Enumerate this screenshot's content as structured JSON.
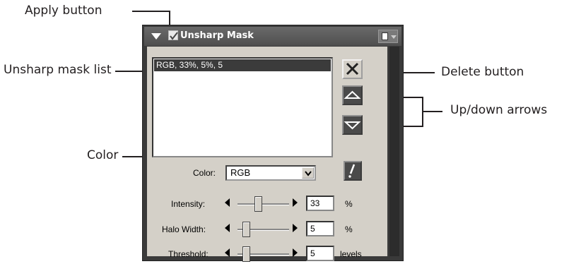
{
  "callouts": {
    "apply_button": "Apply button",
    "unsharp_mask_list": "Unsharp mask list",
    "delete_button": "Delete button",
    "up_down_arrows": "Up/down arrows",
    "color": "Color"
  },
  "palette": {
    "title": "Unsharp Mask",
    "apply_checked": true
  },
  "mask_list": {
    "items": [
      "RGB, 33%, 5%, 5"
    ]
  },
  "color": {
    "label": "Color:",
    "selected": "RGB"
  },
  "sliders": [
    {
      "label": "Intensity:",
      "value": "33",
      "unit": "%",
      "level": 0.33
    },
    {
      "label": "Halo Width:",
      "value": "5",
      "unit": "%",
      "level": 0.05
    },
    {
      "label": "Threshold:",
      "value": "5",
      "unit": "levels",
      "level": 0.05
    }
  ],
  "icons": {
    "collapse": "triangle-down-icon",
    "apply": "checkbox-icon",
    "menu": "document-icon",
    "delete": "x-icon",
    "up": "triangle-up-icon",
    "down": "triangle-down-icon",
    "reset": "exclamation-icon"
  }
}
